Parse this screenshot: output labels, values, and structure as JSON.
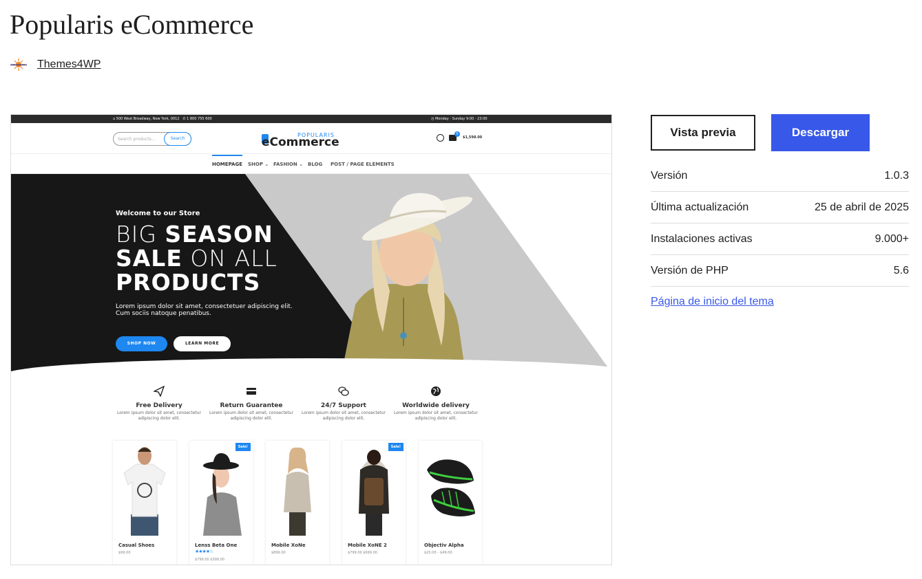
{
  "theme": {
    "title": "Popularis eCommerce",
    "author": "Themes4WP",
    "author_logo_icon": "themes4wp-logo-icon"
  },
  "actions": {
    "preview_label": "Vista previa",
    "download_label": "Descargar",
    "download_color": "#3858e9"
  },
  "meta": [
    {
      "label": "Versión",
      "value": "1.0.3"
    },
    {
      "label": "Última actualización",
      "value": "25 de abril de 2025"
    },
    {
      "label": "Instalaciones activas",
      "value": "9.000+"
    },
    {
      "label": "Versión de PHP",
      "value": "5.6"
    }
  ],
  "homepage_link": "Página de inicio del tema",
  "screenshot": {
    "topbar_address": "500 West Broadway, New York, 0012",
    "topbar_phone": "1 800 755 600",
    "topbar_hours": "Monday - Sunday 9:00 - 23:00",
    "search_placeholder": "Search products...",
    "search_button": "Search",
    "logo_small": "POPULARIS",
    "logo_main": "eCommerce",
    "cart_count": "0",
    "cart_total": "$1,598.00",
    "menu": [
      "HOMEPAGE",
      "SHOP ⌄",
      "FASHION ⌄",
      "BLOG",
      "POST / PAGE ELEMENTS"
    ],
    "hero": {
      "welcome": "Welcome to our Store",
      "line1_thin": "BIG ",
      "line1_bold": "SEASON",
      "line2_bold": "SALE",
      "line2_thin": " ON ALL",
      "line3_bold": "PRODUCTS",
      "lorem": "Lorem ipsum dolor sit amet, consectetuer adipiscing elit. Cum sociis natoque penatibus.",
      "shop_now": "SHOP NOW",
      "learn_more": "LEARN MORE"
    },
    "features": [
      {
        "icon": "paper-plane-icon",
        "title": "Free Delivery",
        "desc": "Lorem ipsum dolor sit amet, consectetur adipiscing dolor elit."
      },
      {
        "icon": "credit-card-icon",
        "title": "Return Guarantee",
        "desc": "Lorem ipsum dolor sit amet, consectetur adipiscing dolor elit."
      },
      {
        "icon": "chat-bubbles-icon",
        "title": "24/7 Support",
        "desc": "Lorem ipsum dolor sit amet, consectetur adipiscing dolor elit."
      },
      {
        "icon": "globe-icon",
        "title": "Worldwide delivery",
        "desc": "Lorem ipsum dolor sit amet, consectetur adipiscing dolor elit."
      }
    ],
    "products": [
      {
        "name": "Casual Shoes",
        "price": "$99.00",
        "sale": ""
      },
      {
        "name": "Lenss Beta One",
        "price": "$799.00 $599.00",
        "sale": "Sale!",
        "rating": "★★★★☆"
      },
      {
        "name": "Mobile XoNe",
        "price": "$899.00",
        "sale": ""
      },
      {
        "name": "Mobile XoNE 2",
        "price": "$799.00 $699.00",
        "sale": "Sale!"
      },
      {
        "name": "Objectiv Alpha",
        "price": "$20.00 – $49.00",
        "sale": ""
      }
    ]
  }
}
